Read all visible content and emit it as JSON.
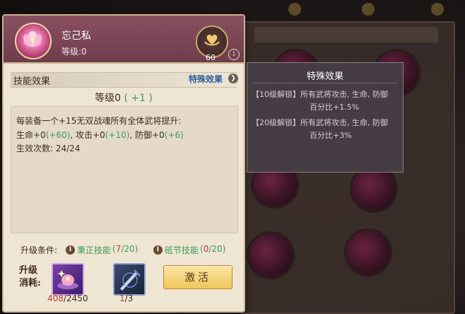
{
  "skill": {
    "name": "忘己私",
    "level_text": "等级:0",
    "heart_count": "60",
    "info_glyph": "i"
  },
  "section": {
    "label": "技能效果",
    "special_link": "特殊效果",
    "arrow_glyph": "❯"
  },
  "level_line": {
    "prefix": "等级0",
    "bonus": "( +1 )"
  },
  "description": {
    "line1": "每装备一个+15无双战魂所有全体武将提升:",
    "line2_a": "生命+0",
    "line2_b": "(+60)",
    "line2_c": ", 攻击+0",
    "line2_d": "(+10)",
    "line2_e": ", 防御+0",
    "line2_f": "(+6)",
    "line3": "生效次数: 24/24"
  },
  "upgrade": {
    "cond_label": "升级条件:",
    "cond1_name": "秉正技能",
    "cond1_open": "(",
    "cond1_current": "7",
    "cond1_rest": "/20)",
    "cond2_name": "砥节技能",
    "cond2_open": "(",
    "cond2_current": "0",
    "cond2_rest": "/20)",
    "cost_label_1": "升级",
    "cost_label_2": "消耗:",
    "item1_current": "408",
    "item1_total": "/2450",
    "item2_current": "1",
    "item2_total": "/3",
    "activate_label": "激活"
  },
  "tooltip": {
    "title": "特殊效果",
    "line1": "【10级解锁】所有武将攻击, 生命, 防御",
    "line1b": "百分比+1.5%",
    "line2": "【20级解锁】所有武将攻击, 生命, 防御",
    "line2b": "百分比+3%"
  },
  "colors": {
    "header": "#7a4654",
    "card": "#efe5d3",
    "green": "#3a9a5a",
    "red": "#c23a2a",
    "link_blue": "#2b5d9a"
  },
  "icons": [
    "lotus-icon",
    "heart-hands-icon",
    "info-icon",
    "chevron-right-icon",
    "purple-flower-item-icon",
    "sword-item-icon"
  ]
}
